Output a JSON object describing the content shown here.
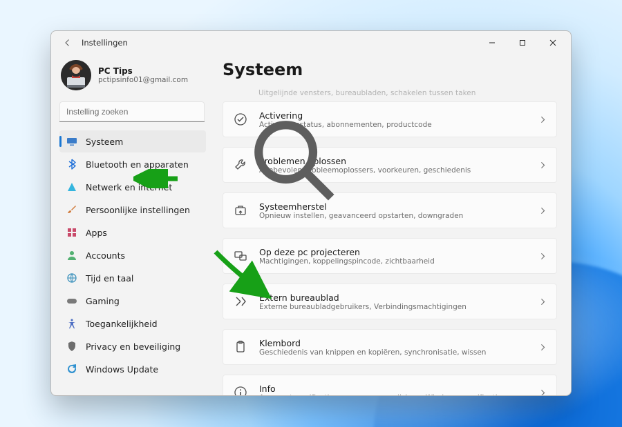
{
  "window": {
    "title": "Instellingen"
  },
  "profile": {
    "name": "PC Tips",
    "email": "pctipsinfo01@gmail.com"
  },
  "search": {
    "placeholder": "Instelling zoeken"
  },
  "sidebar": {
    "items": [
      {
        "id": "system",
        "label": "Systeem",
        "icon": "monitor",
        "color": "#3a7cc9",
        "selected": true
      },
      {
        "id": "bluetooth",
        "label": "Bluetooth en apparaten",
        "icon": "bluetooth",
        "color": "#1e6fd8"
      },
      {
        "id": "network",
        "label": "Netwerk en internet",
        "icon": "wifi",
        "color": "#34b5de"
      },
      {
        "id": "personal",
        "label": "Persoonlijke instellingen",
        "icon": "brush",
        "color": "#d07a3b"
      },
      {
        "id": "apps",
        "label": "Apps",
        "icon": "apps",
        "color": "#c94a6a"
      },
      {
        "id": "accounts",
        "label": "Accounts",
        "icon": "person",
        "color": "#52b071"
      },
      {
        "id": "time",
        "label": "Tijd en taal",
        "icon": "globe",
        "color": "#4a99c0"
      },
      {
        "id": "gaming",
        "label": "Gaming",
        "icon": "gamepad",
        "color": "#7a7a7a"
      },
      {
        "id": "accessibility",
        "label": "Toegankelijkheid",
        "icon": "access",
        "color": "#4f70c4"
      },
      {
        "id": "privacy",
        "label": "Privacy en beveiliging",
        "icon": "shield",
        "color": "#6d6d6d"
      },
      {
        "id": "update",
        "label": "Windows Update",
        "icon": "update",
        "color": "#2f91d0"
      }
    ]
  },
  "page": {
    "title": "Systeem",
    "faded_caption": "Uitgelijnde vensters, bureaubladen, schakelen tussen taken",
    "items": [
      {
        "id": "activering",
        "title": "Activering",
        "sub": "Activeringsstatus, abonnementen, productcode",
        "icon": "check"
      },
      {
        "id": "problemen",
        "title": "Problemen oplossen",
        "sub": "Aanbevolen probleemoplossers, voorkeuren, geschiedenis",
        "icon": "wrench"
      },
      {
        "id": "herstel",
        "title": "Systeemherstel",
        "sub": "Opnieuw instellen, geavanceerd opstarten, downgraden",
        "icon": "recovery"
      },
      {
        "id": "projecteren",
        "title": "Op deze pc projecteren",
        "sub": "Machtigingen, koppelingspincode, zichtbaarheid",
        "icon": "project"
      },
      {
        "id": "extern",
        "title": "Extern bureaublad",
        "sub": "Externe bureaubladgebruikers, Verbindingsmachtigingen",
        "icon": "remote"
      },
      {
        "id": "klembord",
        "title": "Klembord",
        "sub": "Geschiedenis van knippen en kopiëren, synchronisatie, wissen",
        "icon": "clipboard"
      },
      {
        "id": "info",
        "title": "Info",
        "sub": "Apparaatspecificaties, naam van pc wijzigen, Windows-specificaties",
        "icon": "info"
      }
    ]
  }
}
